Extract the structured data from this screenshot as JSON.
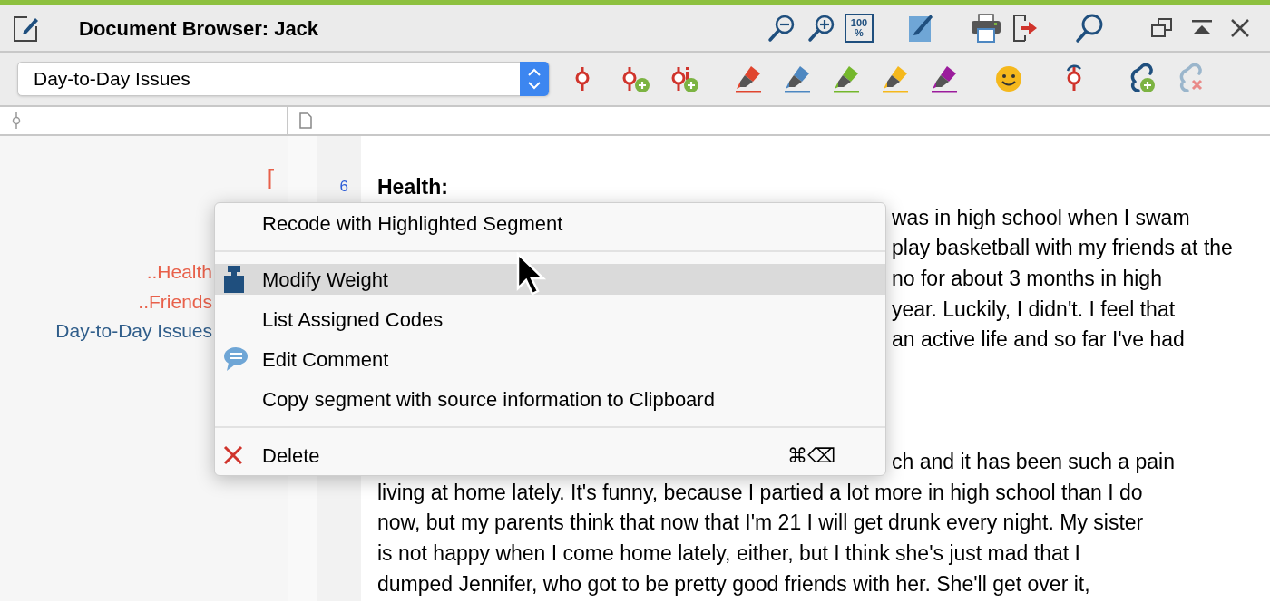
{
  "window": {
    "title": "Document Browser: Jack",
    "zoom_reset_label": [
      "100",
      "%"
    ]
  },
  "toolbar": {
    "code_selector": {
      "value": "Day-to-Day Issues"
    },
    "highlighters": [
      {
        "color": "#e0452e"
      },
      {
        "color": "#4d87c1"
      },
      {
        "color": "#74b72c"
      },
      {
        "color": "#f5b81c"
      },
      {
        "color": "#9b1c9c"
      }
    ]
  },
  "codes": [
    {
      "label": "..Health",
      "color": "#e8604a"
    },
    {
      "label": "..Friends",
      "color": "#e8604a"
    },
    {
      "label": "Day-to-Day Issues",
      "color": "#2f5d8a"
    }
  ],
  "document": {
    "lines": [
      {
        "kind": "heading",
        "number": "6",
        "text": "Health:"
      },
      {
        "kind": "tail",
        "text": "was in high school when I swam"
      },
      {
        "kind": "tail",
        "text": "play basketball with my friends at the"
      },
      {
        "kind": "tail",
        "text": "no for about 3 months in high"
      },
      {
        "kind": "tail",
        "text": "year.  Luckily, I didn't.  I feel that"
      },
      {
        "kind": "tail",
        "text": "an active life and so far I've had"
      }
    ],
    "continued_lines": [
      {
        "kind": "tail",
        "text": "ch and it has been such a pain"
      },
      {
        "kind": "text",
        "text": "living at home lately.  It's funny, because I partied a lot more in high school than I do"
      },
      {
        "kind": "text",
        "text": "now, but my parents think that now that I'm 21 I will get drunk every night.  My sister"
      },
      {
        "kind": "text",
        "text": "is not happy when I come home lately, either, but I think she's just mad that I"
      },
      {
        "kind": "text",
        "text": "dumped Jennifer, who got to be pretty good friends with her.  She'll get over it,"
      }
    ]
  },
  "context_menu": {
    "items": [
      {
        "kind": "item",
        "label": "Recode with Highlighted Segment",
        "selected": false
      },
      {
        "kind": "separator"
      },
      {
        "kind": "item",
        "label": "Modify Weight",
        "selected": true
      },
      {
        "kind": "item",
        "label": "List Assigned Codes",
        "selected": false
      },
      {
        "kind": "item",
        "label": "Edit Comment",
        "selected": false
      },
      {
        "kind": "item",
        "label": "Copy segment with source information to Clipboard",
        "selected": false
      },
      {
        "kind": "separator"
      },
      {
        "kind": "item",
        "label": "Delete",
        "selected": false,
        "shortcut": "⌘⌫"
      }
    ]
  }
}
